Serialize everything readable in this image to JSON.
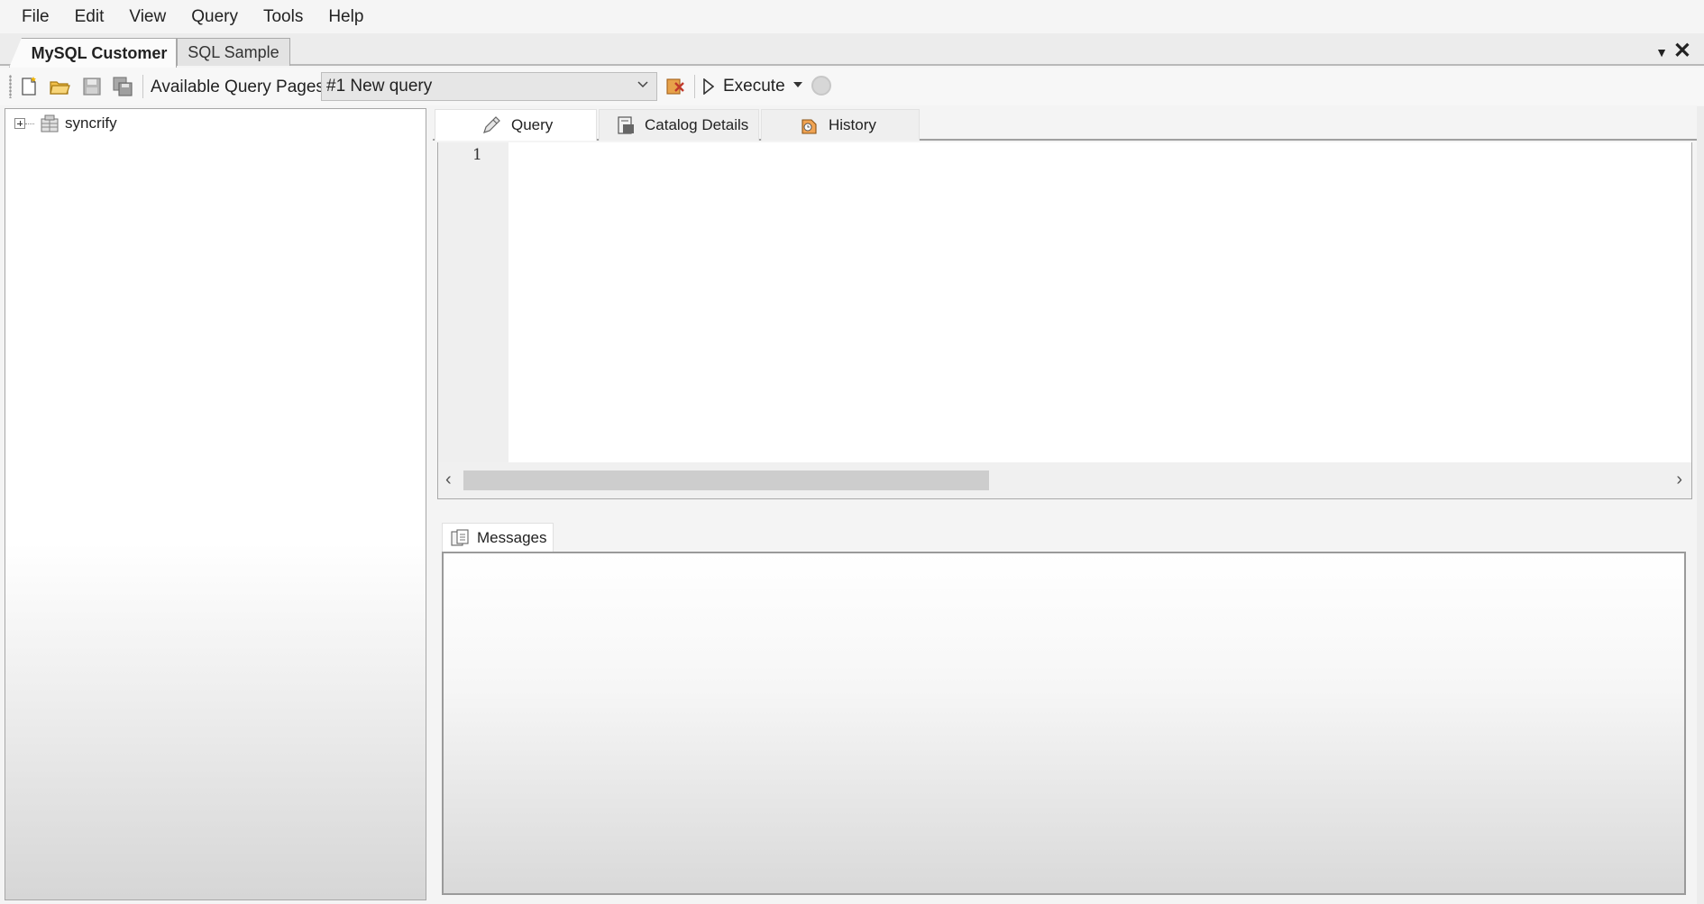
{
  "menu": {
    "items": [
      "File",
      "Edit",
      "View",
      "Query",
      "Tools",
      "Help"
    ]
  },
  "doc_tabs": {
    "tabs": [
      {
        "label": "MySQL Customer",
        "active": true
      },
      {
        "label": "SQL Sample",
        "active": false
      }
    ]
  },
  "toolbar": {
    "available_pages_label": "Available Query Pages:",
    "selected_page": "#1 New query",
    "execute_label": "Execute",
    "icons": [
      "new-query-icon",
      "open-folder-icon",
      "save-icon",
      "save-all-icon",
      "clear-icon",
      "stop-icon"
    ]
  },
  "tree": {
    "root": {
      "label": "syncrify",
      "expanded": false,
      "icon": "database-icon"
    }
  },
  "editor": {
    "tabs": [
      {
        "label": "Query",
        "icon": "pencil-icon",
        "active": true
      },
      {
        "label": "Catalog Details",
        "icon": "catalog-icon",
        "active": false
      },
      {
        "label": "History",
        "icon": "history-icon",
        "active": false
      }
    ],
    "line_numbers": [
      "1"
    ],
    "content": ""
  },
  "messages": {
    "tab_label": "Messages",
    "content": ""
  },
  "colors": {
    "window_bg": "#f4f4f4",
    "panel_border": "#a9a9a9",
    "active_tab_bg": "#ffffff"
  }
}
